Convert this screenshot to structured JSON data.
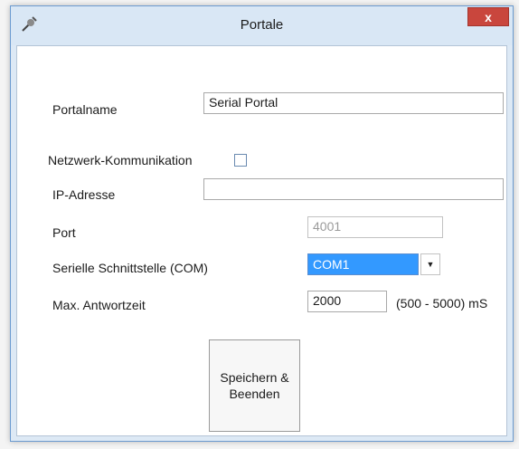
{
  "window": {
    "title": "Portale",
    "close_label": "x"
  },
  "form": {
    "portalname": {
      "label": "Portalname",
      "value": "Serial Portal"
    },
    "network": {
      "label": "Netzwerk-Kommunikation",
      "checked": false
    },
    "ip": {
      "label": "IP-Adresse",
      "value": ""
    },
    "port": {
      "label": "Port",
      "value": "4001",
      "disabled": true
    },
    "com": {
      "label": "Serielle Schnittstelle (COM)",
      "value": "COM1"
    },
    "timeout": {
      "label": "Max. Antwortzeit",
      "value": "2000",
      "range": "(500 - 5000) mS"
    }
  },
  "buttons": {
    "save_line1": "Speichern &",
    "save_line2": "Beenden"
  },
  "icons": {
    "app": "gear-plug-icon",
    "close": "close-icon",
    "dropdown": "chevron-down-icon"
  },
  "colors": {
    "close_button": "#c9463d",
    "selection": "#3399ff",
    "titlebar": "#d9e7f5"
  }
}
